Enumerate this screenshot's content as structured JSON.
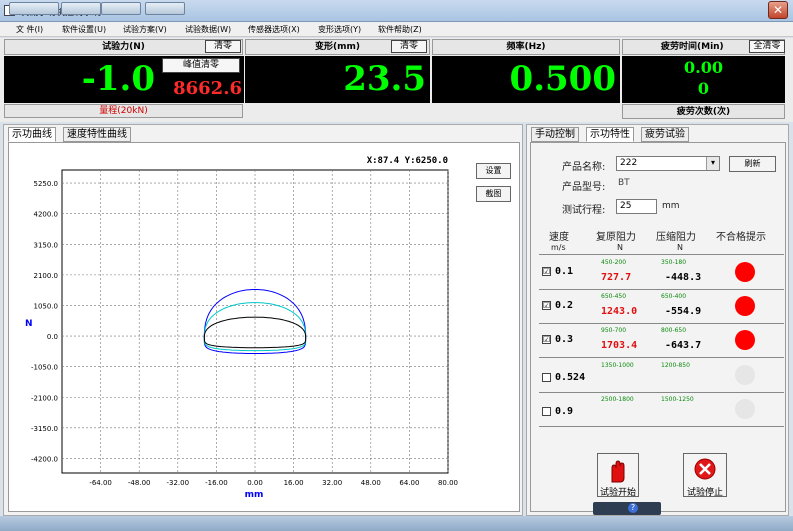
{
  "window": {
    "title": "机械示功机控制系统V2.1",
    "close": "✕"
  },
  "menu": [
    "文 件(I)",
    "软件设置(U)",
    "试验方案(V)",
    "试验数据(W)",
    "传感器选项(X)",
    "变形选项(Y)",
    "软件帮助(Z)"
  ],
  "gauges": {
    "force": {
      "label": "试验力(N)",
      "clear": "清零",
      "value": "-1.0",
      "peak_clear": "峰值清零",
      "peak_value": "8662.6",
      "range": "量程(20kN)"
    },
    "deform": {
      "label": "变形(mm)",
      "clear": "清零",
      "value": "23.5"
    },
    "freq": {
      "label": "频率(Hz)",
      "value": "0.500"
    },
    "fatigue": {
      "label": "疲劳时间(Min)",
      "clear_all": "全清零",
      "time": "0.00",
      "count": "0",
      "count_label": "疲劳次数(次)"
    }
  },
  "left_tabs": [
    "示功曲线",
    "速度特性曲线"
  ],
  "chart_buttons": {
    "setup": "设置",
    "capture": "截图"
  },
  "chart_data": {
    "type": "line",
    "readout": "X:87.4 Y:6250.0",
    "ylabel": "N",
    "xlabel": "mm",
    "xlim": [
      -80,
      80
    ],
    "ylim": [
      -4700,
      5700
    ],
    "xticks": [
      "-64.00",
      "-48.00",
      "-32.00",
      "-16.00",
      "0.00",
      "16.00",
      "32.00",
      "48.00",
      "64.00",
      "80.00"
    ],
    "yticks": [
      "5250.0",
      "4200.0",
      "3150.0",
      "2100.0",
      "1050.0",
      "0.0",
      "-1050.0",
      "-2100.0",
      "-3150.0",
      "-4200.0"
    ],
    "series": [
      {
        "color": "#0000ff",
        "top_peak": 1650,
        "bottom": -600,
        "xmin": -21,
        "xmax": 21
      },
      {
        "color": "#00c8c8",
        "top_peak": 1200,
        "bottom": -500,
        "xmin": -21,
        "xmax": 21
      },
      {
        "color": "#000000",
        "top_peak": 700,
        "bottom": -400,
        "xmin": -21,
        "xmax": 21
      }
    ]
  },
  "right_tabs": [
    "手动控制",
    "示功特性",
    "疲劳试验"
  ],
  "product": {
    "name_label": "产品名称:",
    "name_value": "222",
    "refresh": "刷新",
    "model_label": "产品型号:",
    "model_value": "BT",
    "stroke_label": "测试行程:",
    "stroke_value": "25",
    "stroke_unit": "mm"
  },
  "table": {
    "headers": [
      "速度",
      "复原阻力",
      "压缩阻力",
      "不合格提示"
    ],
    "units": [
      "m/s",
      "N",
      "N"
    ],
    "rows": [
      {
        "checked": "☑",
        "speed": "0.1",
        "rebound_range": "450-200",
        "compress_range": "350-180",
        "rebound": "727.7",
        "compress": "-448.3",
        "status_color": "#ff0000"
      },
      {
        "checked": "☑",
        "speed": "0.2",
        "rebound_range": "650-450",
        "compress_range": "650-400",
        "rebound": "1243.0",
        "compress": "-554.9",
        "status_color": "#ff0000"
      },
      {
        "checked": "☑",
        "speed": "0.3",
        "rebound_range": "950-700",
        "compress_range": "800-650",
        "rebound": "1703.4",
        "compress": "-643.7",
        "status_color": "#ff0000"
      },
      {
        "checked": "",
        "speed": "0.524",
        "rebound_range": "1350-1000",
        "compress_range": "1200-850",
        "rebound": "",
        "compress": "",
        "status_color": "#e6e6e6"
      },
      {
        "checked": "",
        "speed": "0.9",
        "rebound_range": "2500-1800",
        "compress_range": "1500-1250",
        "rebound": "",
        "compress": "",
        "status_color": "#e6e6e6"
      }
    ]
  },
  "actions": {
    "start": "试验开始",
    "stop": "试验停止"
  }
}
